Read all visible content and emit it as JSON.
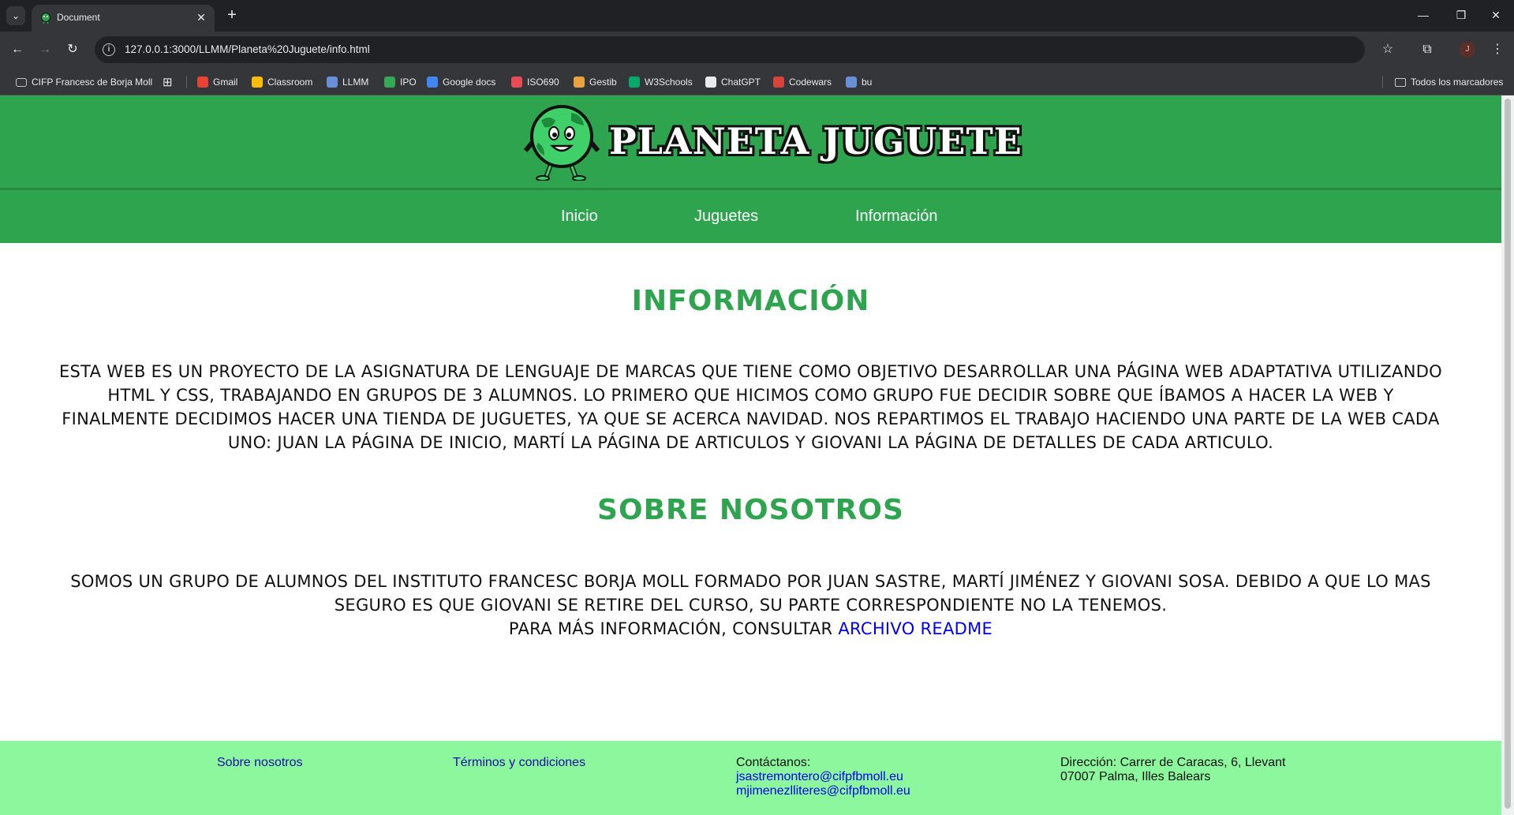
{
  "browser": {
    "tab_title": "Document",
    "url": "127.0.0.1:3000/LLMM/Planeta%20Juguete/info.html",
    "profile_initial": "J",
    "bookmarks": [
      {
        "label": "CIFP Francesc de Borja Moll",
        "icon": "folder-icon",
        "color": "#c4c7c5"
      },
      {
        "label": "Gmail",
        "icon": "gmail-icon",
        "color": "#ea4335"
      },
      {
        "label": "Classroom",
        "icon": "classroom-icon",
        "color": "#fbbc04"
      },
      {
        "label": "LLMM",
        "icon": "moodle-icon",
        "color": "#6a8fd8"
      },
      {
        "label": "IPO",
        "icon": "ipo-icon",
        "color": "#34a853"
      },
      {
        "label": "Google docs",
        "icon": "docs-icon",
        "color": "#4285f4"
      },
      {
        "label": "ISO690",
        "icon": "iso690-icon",
        "color": "#e94b55"
      },
      {
        "label": "Gestib",
        "icon": "gestib-icon",
        "color": "#e8a33d"
      },
      {
        "label": "W3Schools",
        "icon": "w3schools-icon",
        "color": "#04aa6d"
      },
      {
        "label": "ChatGPT",
        "icon": "chatgpt-icon",
        "color": "#e8eaed"
      },
      {
        "label": "Codewars",
        "icon": "codewars-icon",
        "color": "#d9413b"
      },
      {
        "label": "bu",
        "icon": "moodle-icon",
        "color": "#6a8fd8"
      }
    ],
    "all_bookmarks": "Todos los marcadores"
  },
  "site": {
    "brand": "PLANETA JUGUETE",
    "nav": [
      "Inicio",
      "Juguetes",
      "Información"
    ],
    "info_title": "INFORMACIÓN",
    "info_text": "Esta web es un proyecto de la asignatura de Lenguaje de Marcas que tiene como objetivo desarrollar una página web adaptativa utilizando HTML y CSS, trabajando en grupos de 3 alumnos. Lo primero que hicimos como grupo fue decidir sobre que íbamos a hacer la web y finalmente decidimos hacer una tienda de juguetes, ya que se acerca Navidad. Nos repartimos el trabajo haciendo una parte de la web cada uno: Juan la página de inicio, Martí la página de articulos y Giovani la página de detalles de cada articulo.",
    "about_title": "SOBRE NOSOTROS",
    "about_text": "Somos un grupo de alumnos del Instituto Francesc Borja Moll formado por Juan Sastre, Martí Jiménez y Giovani Sosa. Debido a que lo mas seguro es que Giovani se retire del curso, su parte correspondiente no la tenemos.",
    "more_info": "Para más información, consultar",
    "readme_link": "archivo README",
    "footer": {
      "about": "Sobre nosotros",
      "terms": "Términos y condiciones",
      "contact_label": "Contáctanos:",
      "emails": [
        "jsastremontero@cifpfbmoll.eu",
        "mjimenezlliteres@cifpfbmoll.eu"
      ],
      "address_line1": "Dirección: Carrer de Caracas, 6, Llevant",
      "address_line2": "07007 Palma, Illes Balears"
    }
  }
}
